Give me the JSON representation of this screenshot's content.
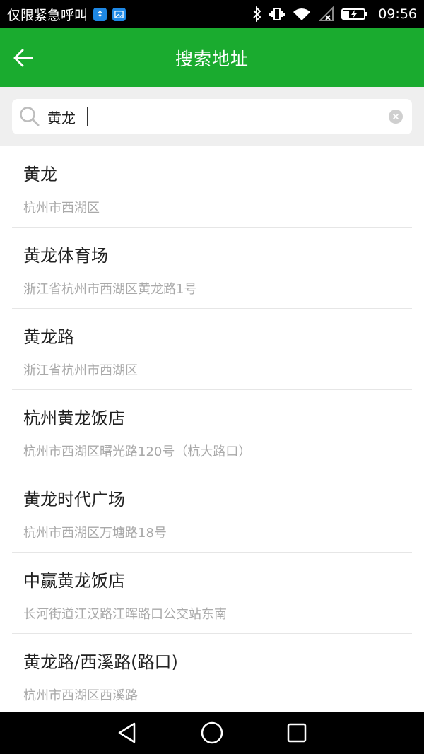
{
  "status_bar": {
    "carrier_text": "仅限紧急呼叫",
    "time": "09:56",
    "icons": [
      "usb-icon",
      "image-icon",
      "bluetooth-icon",
      "vibrate-icon",
      "wifi-icon",
      "signal-icon",
      "battery-charging-icon"
    ]
  },
  "app_bar": {
    "title": "搜索地址",
    "back_icon": "arrow-left-icon",
    "color": "#1aab2f"
  },
  "search": {
    "value": "黄龙",
    "placeholder": ""
  },
  "results": [
    {
      "name": "黄龙",
      "address": "杭州市西湖区"
    },
    {
      "name": "黄龙体育场",
      "address": "浙江省杭州市西湖区黄龙路1号"
    },
    {
      "name": "黄龙路",
      "address": "浙江省杭州市西湖区"
    },
    {
      "name": "杭州黄龙饭店",
      "address": "杭州市西湖区曙光路120号（杭大路口）"
    },
    {
      "name": "黄龙时代广场",
      "address": "杭州市西湖区万塘路18号"
    },
    {
      "name": "中赢黄龙饭店",
      "address": "长河街道江汉路江晖路口公交站东南"
    },
    {
      "name": "黄龙路/西溪路(路口)",
      "address": "杭州市西湖区西溪路"
    }
  ],
  "nav_bar": {
    "icons": [
      "back-triangle-icon",
      "home-circle-icon",
      "recents-square-icon"
    ]
  }
}
